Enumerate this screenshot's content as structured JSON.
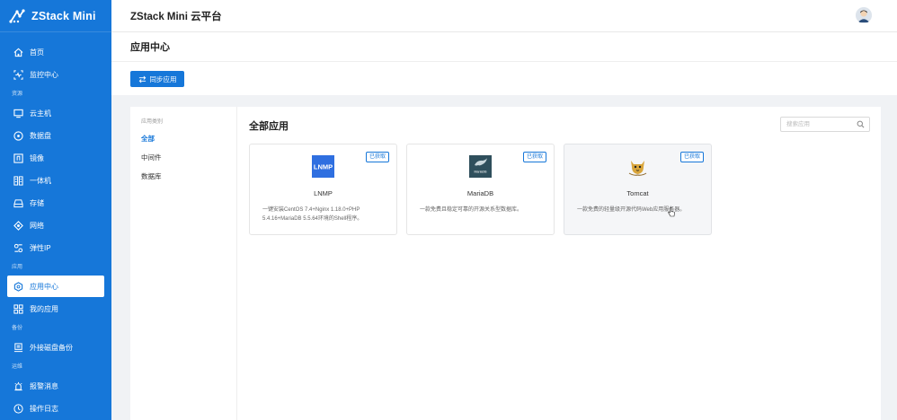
{
  "brand": {
    "name": "ZStack Mini"
  },
  "topbar": {
    "title": "ZStack Mini 云平台"
  },
  "sidebar": {
    "items": [
      {
        "label": "首页",
        "icon": "home-icon"
      },
      {
        "label": "监控中心",
        "icon": "monitor-icon"
      },
      {
        "section": "资源"
      },
      {
        "label": "云主机",
        "icon": "vm-icon"
      },
      {
        "label": "数据盘",
        "icon": "disk-icon"
      },
      {
        "label": "镜像",
        "icon": "image-icon"
      },
      {
        "label": "一体机",
        "icon": "appliance-icon"
      },
      {
        "label": "存储",
        "icon": "storage-icon"
      },
      {
        "label": "网络",
        "icon": "network-icon"
      },
      {
        "label": "弹性IP",
        "icon": "eip-icon"
      },
      {
        "section": "应用"
      },
      {
        "label": "应用中心",
        "icon": "app-center-icon",
        "active": true
      },
      {
        "label": "我的应用",
        "icon": "my-apps-icon"
      },
      {
        "section": "备份"
      },
      {
        "label": "外接磁盘备份",
        "icon": "backup-icon"
      },
      {
        "section": "运维"
      },
      {
        "label": "报警消息",
        "icon": "alarm-icon"
      },
      {
        "label": "操作日志",
        "icon": "log-icon"
      }
    ]
  },
  "page": {
    "title": "应用中心",
    "sync_button": "同步应用"
  },
  "categories": {
    "heading": "应用类别",
    "items": [
      {
        "label": "全部",
        "active": true
      },
      {
        "label": "中间件"
      },
      {
        "label": "数据库"
      }
    ]
  },
  "apps": {
    "title": "全部应用",
    "search_placeholder": "搜索应用",
    "cards": [
      {
        "name": "LNMP",
        "badge": "已获取",
        "desc": "一键安装CentOS 7.4+Nginx 1.18.0+PHP 5.4.16+MariaDB 5.5.64环境的Shell程序。",
        "logo": "lnmp-logo",
        "logo_text": "LNMP",
        "logo_color": "#2f6fe0"
      },
      {
        "name": "MariaDB",
        "badge": "已获取",
        "desc": "一款免费且稳定可靠的开源关系型数据库。",
        "logo": "mariadb-logo",
        "logo_text": "MariaDB",
        "logo_color": "#2f4f5c"
      },
      {
        "name": "Tomcat",
        "badge": "已获取",
        "desc": "一款免费的轻量级开源代码Web应用服务器。",
        "logo": "tomcat-logo",
        "logo_color": "#d9a53b"
      }
    ]
  },
  "colors": {
    "primary": "#1677d9",
    "background": "#f0f2f5"
  }
}
